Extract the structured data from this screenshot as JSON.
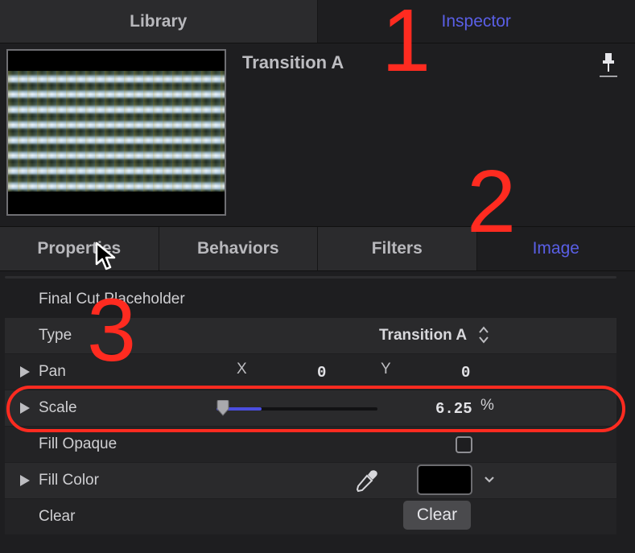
{
  "top_tabs": {
    "library": "Library",
    "inspector": "Inspector"
  },
  "preview": {
    "title": "Transition A",
    "pin_icon": "pin-icon"
  },
  "sub_tabs": [
    "Properties",
    "Behaviors",
    "Filters",
    "Image"
  ],
  "active_sub_tab": "Image",
  "annotations": [
    "1",
    "2",
    "3"
  ],
  "group_title": "Final Cut Placeholder",
  "rows": {
    "type": {
      "label": "Type",
      "value": "Transition A"
    },
    "pan": {
      "label": "Pan",
      "x_label": "X",
      "x_value": "0",
      "y_label": "Y",
      "y_value": "0"
    },
    "scale": {
      "label": "Scale",
      "value": "6.25",
      "unit": "%",
      "slider_fraction": 0.0625
    },
    "fill_opaque": {
      "label": "Fill Opaque",
      "checked": false
    },
    "fill_color": {
      "label": "Fill Color",
      "color": "#000000"
    },
    "clear": {
      "label": "Clear",
      "button": "Clear"
    }
  },
  "colors": {
    "accent": "#5a5fe6",
    "annotation": "#ff2b20",
    "slider": "#4b4ee0"
  }
}
